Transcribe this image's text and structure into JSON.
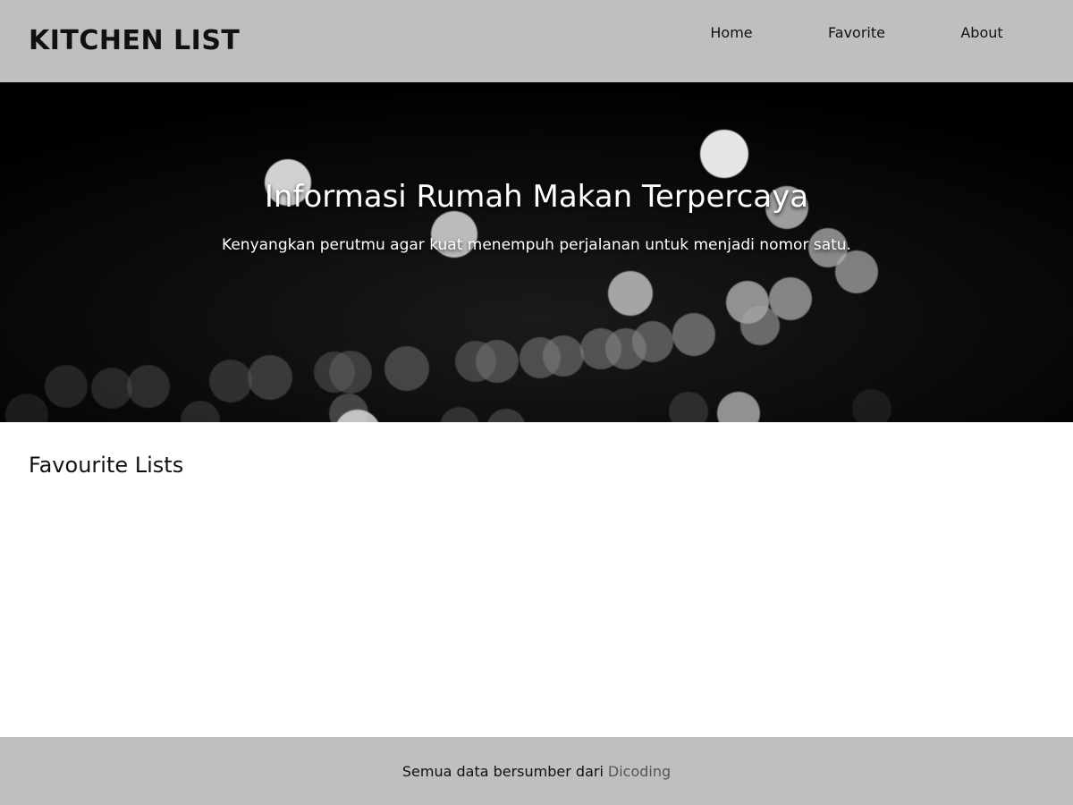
{
  "header": {
    "brand": "KITCHEN LIST",
    "nav": [
      {
        "label": "Home"
      },
      {
        "label": "Favorite"
      },
      {
        "label": "About"
      }
    ]
  },
  "hero": {
    "title": "Informasi Rumah Makan Terpercaya",
    "subtitle": "Kenyangkan perutmu agar kuat menempuh perjalanan untuk menjadi nomor satu."
  },
  "main": {
    "section_title": "Favourite Lists",
    "items": []
  },
  "footer": {
    "text": "Semua data bersumber dari",
    "link_label": "Dicoding"
  },
  "colors": {
    "header_bg": "#bfbfbf",
    "footer_bg": "#bfbfbf",
    "hero_bg": "#000000",
    "link_muted": "#555555"
  }
}
